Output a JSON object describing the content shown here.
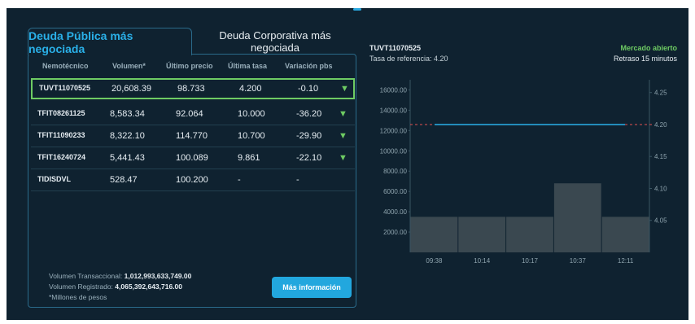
{
  "tabs": {
    "public": "Deuda Pública más negociada",
    "corporate": "Deuda Corporativa más negociada"
  },
  "table": {
    "headers": [
      "Nemotécnico",
      "Volumen*",
      "Último precio",
      "Última tasa",
      "Variación pbs"
    ],
    "rows": [
      {
        "ticker": "TUVT11070525",
        "volume": "20,608.39",
        "price": "98.733",
        "rate": "4.200",
        "change": "-0.10",
        "arrow": "▼",
        "selected": true
      },
      {
        "ticker": "TFIT08261125",
        "volume": "8,583.34",
        "price": "92.064",
        "rate": "10.000",
        "change": "-36.20",
        "arrow": "▼"
      },
      {
        "ticker": "TFIT11090233",
        "volume": "8,322.10",
        "price": "114.770",
        "rate": "10.700",
        "change": "-29.90",
        "arrow": "▼"
      },
      {
        "ticker": "TFIT16240724",
        "volume": "5,441.43",
        "price": "100.089",
        "rate": "9.861",
        "change": "-22.10",
        "arrow": "▼"
      },
      {
        "ticker": "TIDISDVL",
        "volume": "528.47",
        "price": "100.200",
        "rate": "-",
        "change": "-",
        "arrow": ""
      }
    ]
  },
  "footer": {
    "trans_label": "Volumen Transaccional:",
    "trans_value": "1,012,993,633,749.00",
    "reg_label": "Volumen Registrado:",
    "reg_value": "4,065,392,643,716.00",
    "note": "*Millones de pesos",
    "button": "Más información"
  },
  "chart_panel": {
    "ticker": "TUVT11070525",
    "reference": "Tasa de referencia: 4.20",
    "market_status": "Mercado abierto",
    "delay": "Retraso 15 minutos",
    "market_color": "#6ecb63"
  },
  "chart_data": {
    "type": "bar",
    "categories": [
      "09:38",
      "10:14",
      "10:17",
      "10:37",
      "12:11"
    ],
    "values": [
      3500,
      3500,
      3500,
      6800,
      3500
    ],
    "y_left_ticks": [
      "16000.00",
      "14000.00",
      "12000.00",
      "10000.00",
      "8000.00",
      "6000.00",
      "4000.00",
      "2000.00"
    ],
    "y_right_ticks": [
      "4.25",
      "4.20",
      "4.15",
      "4.10",
      "4.05"
    ],
    "ylim_left": [
      0,
      17000
    ],
    "ylim_right": [
      4.0,
      4.27
    ],
    "reference_rate": 4.2,
    "rate_line": 4.2,
    "bar_color": "#3a4850",
    "rate_line_color": "#2ab0e8",
    "reference_line_color": "#e05050"
  }
}
